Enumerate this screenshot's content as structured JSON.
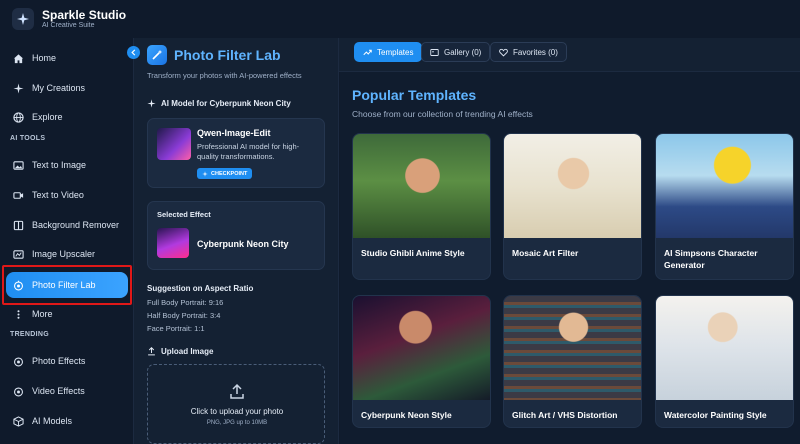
{
  "brand": {
    "title": "Sparkle Studio",
    "subtitle": "AI Creative Suite"
  },
  "sidebar": {
    "items": [
      {
        "label": "Home",
        "icon": "home-icon"
      },
      {
        "label": "My Creations",
        "icon": "sparkle-icon"
      },
      {
        "label": "Explore",
        "icon": "globe-icon"
      }
    ],
    "ai_tools_label": "AI TOOLS",
    "tools": [
      {
        "label": "Text to Image",
        "icon": "image-icon"
      },
      {
        "label": "Text to Video",
        "icon": "video-icon"
      },
      {
        "label": "Background Remover",
        "icon": "layers-icon"
      },
      {
        "label": "Image Upscaler",
        "icon": "upscale-icon"
      },
      {
        "label": "Photo Filter Lab",
        "icon": "filter-icon",
        "active": true
      },
      {
        "label": "More",
        "icon": "more-icon"
      }
    ],
    "trending_label": "TRENDING",
    "trending": [
      {
        "label": "Photo Effects",
        "icon": "filter-icon"
      },
      {
        "label": "Video Effects",
        "icon": "filter-icon"
      },
      {
        "label": "AI Models",
        "icon": "cube-icon"
      }
    ]
  },
  "panel": {
    "title": "Photo Filter Lab",
    "subtitle": "Transform your photos with AI-powered effects",
    "model_section": "AI Model for Cyberpunk Neon City",
    "model": {
      "name": "Qwen-Image-Edit",
      "description": "Professional AI model for high-quality transformations.",
      "badge": "CHECKPOINT"
    },
    "selected_effect_label": "Selected Effect",
    "selected_effect_name": "Cyberpunk Neon City",
    "aspect_title": "Suggestion on Aspect Ratio",
    "aspect_lines": [
      "Full Body Portrait: 9:16",
      "Half Body Portrait: 3:4",
      "Face Portrait: 1:1"
    ],
    "upload_title": "Upload Image",
    "upload_text": "Click to upload your photo",
    "upload_sub": "PNG, JPG up to 10MB"
  },
  "tabs": [
    {
      "label": "Templates",
      "active": true
    },
    {
      "label": "Gallery (0)"
    },
    {
      "label": "Favorites (0)"
    }
  ],
  "main": {
    "title": "Popular Templates",
    "subtitle": "Choose from our collection of trending AI effects",
    "templates": [
      {
        "label": "Studio Ghibli Anime Style"
      },
      {
        "label": "Mosaic Art Filter"
      },
      {
        "label": "AI Simpsons Character Generator"
      },
      {
        "label": "Cyberpunk Neon Style"
      },
      {
        "label": "Glitch Art / VHS Distortion"
      },
      {
        "label": "Watercolor Painting Style"
      }
    ]
  },
  "colors": {
    "accent": "#1f8ef1",
    "title_blue": "#5fb4ff",
    "highlight": "#e01818"
  }
}
